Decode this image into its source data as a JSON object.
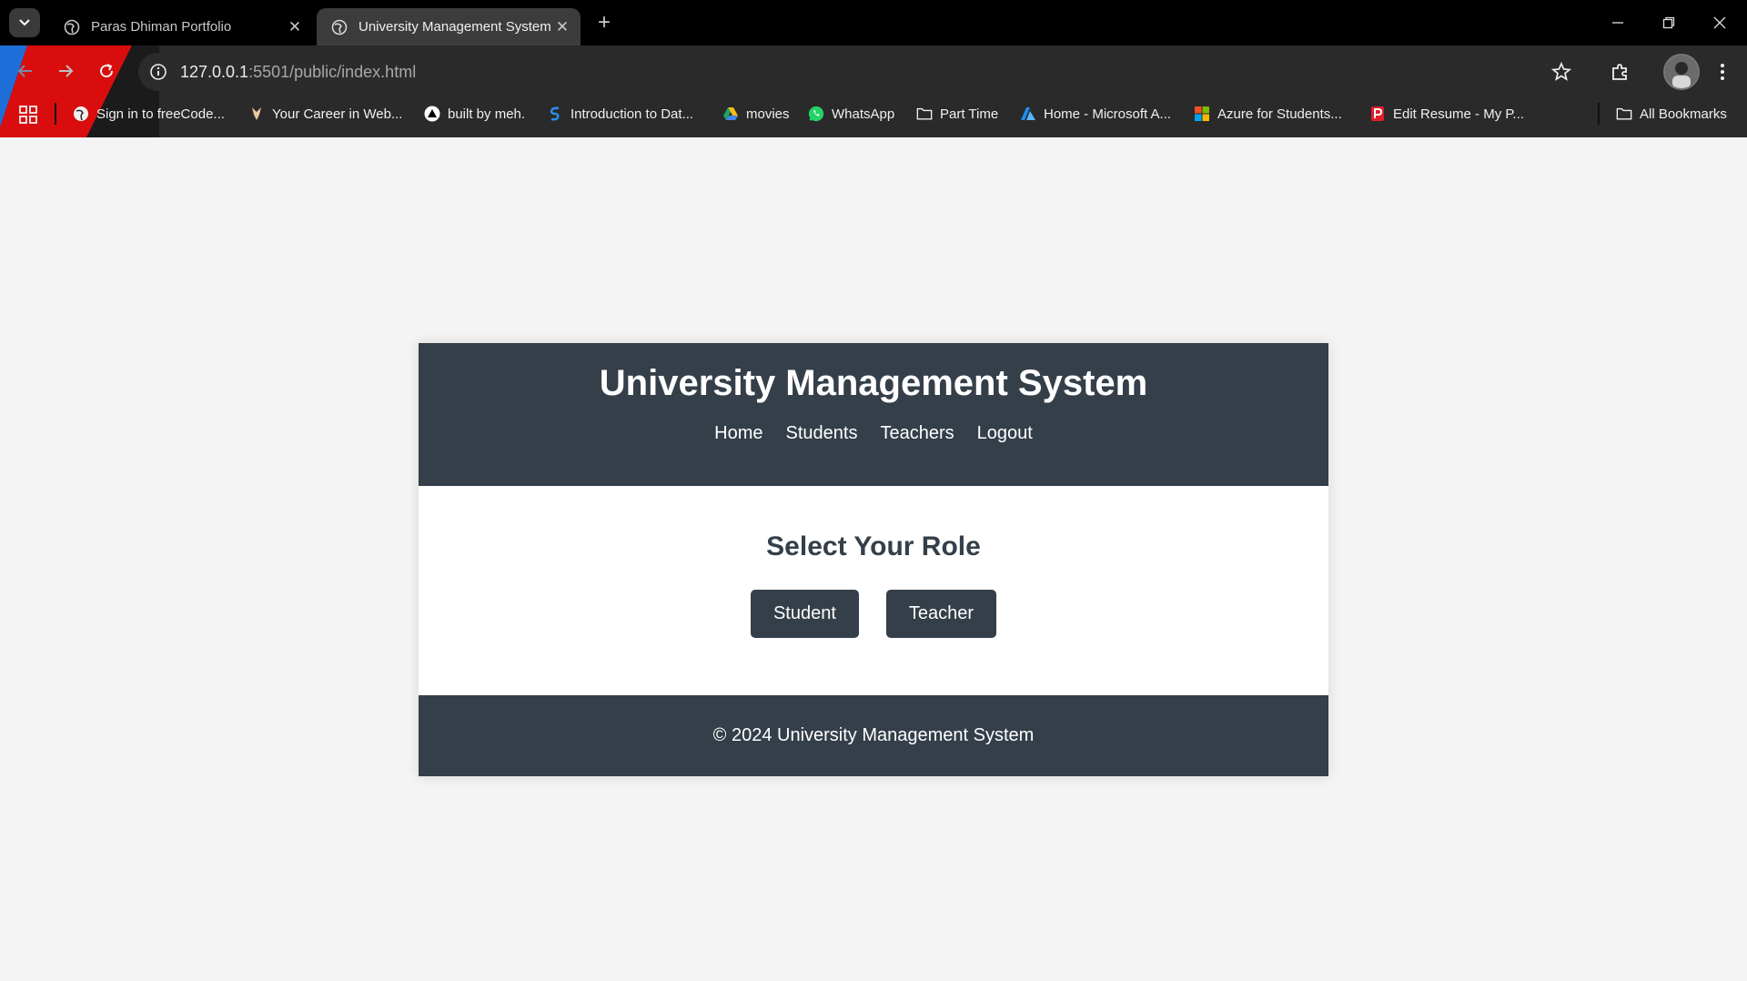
{
  "browser": {
    "tabs": [
      {
        "title": "Paras Dhiman Portfolio",
        "active": false
      },
      {
        "title": "University Management System",
        "active": true
      }
    ],
    "url_host": "127.0.0.1",
    "url_path": ":5501/public/index.html",
    "bookmarks": [
      {
        "label": "Sign in to freeCode...",
        "icon": "globe-icon"
      },
      {
        "label": "Your Career in Web...",
        "icon": "career-icon"
      },
      {
        "label": "built by meh.",
        "icon": "triangle-icon"
      },
      {
        "label": "Introduction to Dat...",
        "icon": "s-logo-icon"
      },
      {
        "label": "movies",
        "icon": "drive-icon"
      },
      {
        "label": "WhatsApp",
        "icon": "whatsapp-icon"
      },
      {
        "label": "Part Time",
        "icon": "folder-icon"
      },
      {
        "label": "Home - Microsoft A...",
        "icon": "azure-icon"
      },
      {
        "label": "Azure for Students...",
        "icon": "microsoft-icon"
      },
      {
        "label": "Edit Resume - My P...",
        "icon": "resume-icon"
      }
    ],
    "all_bookmarks": "All Bookmarks"
  },
  "page": {
    "title": "University Management System",
    "nav": [
      "Home",
      "Students",
      "Teachers",
      "Logout"
    ],
    "heading": "Select Your Role",
    "buttons": {
      "student": "Student",
      "teacher": "Teacher"
    },
    "footer": "© 2024 University Management System"
  },
  "colors": {
    "header_bg": "#343f49",
    "page_bg": "#f4f4f4",
    "card_bg": "#ffffff",
    "button_bg": "#343f49"
  }
}
